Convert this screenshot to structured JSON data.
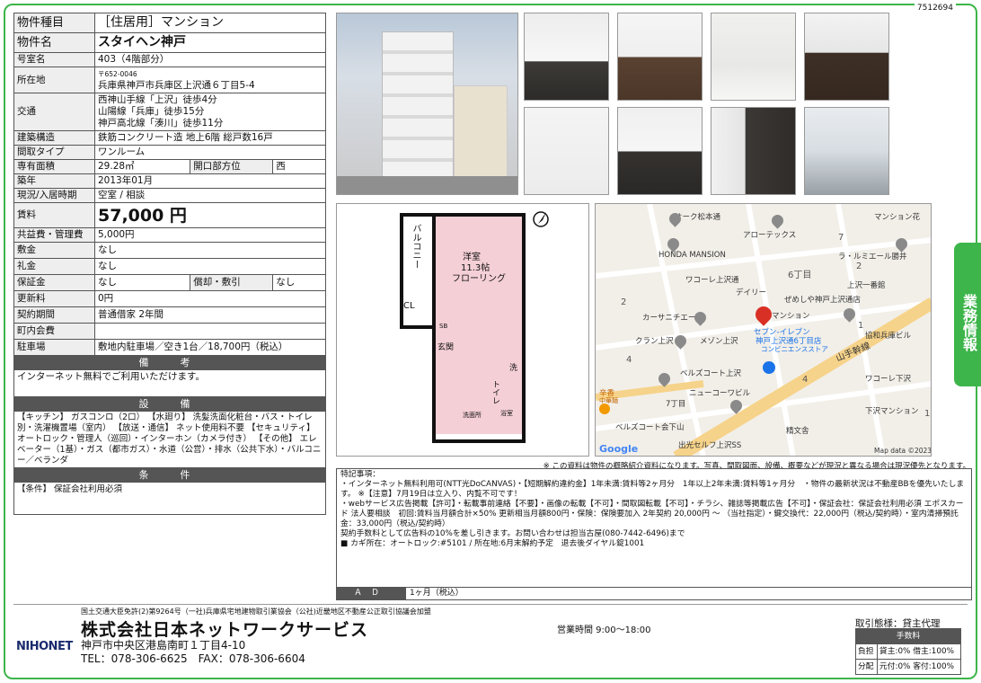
{
  "doc_id": "7512694",
  "side_tab": "業務情報",
  "property": {
    "type_label": "物件種目",
    "type_value": "［住居用］マンション",
    "name_label": "物件名",
    "name_value": "スタイヘン神戸",
    "room_label": "号室名",
    "room_value": "403（4階部分）",
    "location_label": "所在地",
    "postal": "〒652-0046",
    "address": "兵庫県神戸市兵庫区上沢通６丁目5-4",
    "access_label": "交通",
    "access": [
      "西神山手線「上沢」徒歩4分",
      "山陽線「兵庫」徒歩15分",
      "神戸高北線「湊川」徒歩11分"
    ],
    "structure_label": "建築構造",
    "structure_value": "鉄筋コンクリート造 地上6階 総戸数16戸",
    "layout_label": "間取タイプ",
    "layout_value": "ワンルーム",
    "area_label": "専有面積",
    "area_value": "29.28㎡",
    "direction_label": "開口部方位",
    "direction_value": "西",
    "built_label": "築年",
    "built_value": "2013年01月",
    "status_label": "現況/入居時期",
    "status_value": "空室 / 相談",
    "rent_label": "賃料",
    "rent_value": "57,000 円",
    "fee_label": "共益費・管理費",
    "fee_value": "5,000円",
    "deposit_label": "敷金",
    "deposit_value": "なし",
    "key_label": "礼金",
    "key_value": "なし",
    "guarantee_label": "保証金",
    "guarantee_value": "なし",
    "amort_label": "償却・敷引",
    "amort_value": "なし",
    "renewal_label": "更新料",
    "renewal_value": "0円",
    "contract_label": "契約期間",
    "contract_value": "普通借家 2年間",
    "town_label": "町内会費",
    "town_value": "",
    "parking_label": "駐車場",
    "parking_value": "敷地内駐車場／空き1台／18,700円（税込）"
  },
  "sections": {
    "remarks_title": "備　考",
    "remarks_body": "インターネット無料でご利用いただけます。",
    "equipment_title": "設　備",
    "equipment_body": "【キッチン】 ガスコンロ（2口） 【水廻り】 洗髪洗面化粧台・バス・トイレ別・洗濯機置場（室内） 【放送・通信】 ネット使用料不要 【セキュリティ】 オートロック・管理人（巡回）・インターホン（カメラ付き） 【その他】 エレベーター（1基）・ガス（都市ガス）・水道（公営）・排水（公共下水）・バルコニー／ベランダ",
    "conditions_title": "条　件",
    "conditions_body": "【条件】 保証会社利用必須"
  },
  "floorplan": {
    "balcony": "バルコニー",
    "room": "洋室",
    "size": "11.3帖",
    "floor": "フローリング",
    "cl": "CL",
    "sb": "SB",
    "entrance": "玄関",
    "wash": "洗",
    "toilet": "トイレ",
    "bath": "浴室",
    "washroom": "洗面所"
  },
  "map": {
    "labels": [
      "オーク松本通",
      "マンション花",
      "アローテックス",
      "HONDA MANSION",
      "ラ・ルミエール勝井",
      "ワコーレ上沢通",
      "6丁目",
      "上沢一番館",
      "デイリー",
      "ぜめしや神戸上沢通店",
      "カーサニチエー",
      "マンション",
      "クラン上沢",
      "メゾン上沢",
      "セブン-イレブン",
      "神戸上沢通6丁目店",
      "コンビニエンスストア",
      "協和兵庫ビル",
      "山手幹線",
      "ベルズコート上沢",
      "ワコーレ下沢",
      "ニューコーワビル",
      "辛香",
      "中華麺",
      "7丁目",
      "下沢マンション",
      "ベルズコート会下山",
      "精文舎",
      "出光セルフ上沢SS",
      "Google",
      "Map data ©2023"
    ],
    "numbers": [
      "7",
      "2",
      "2",
      "4",
      "1",
      "4",
      "1"
    ]
  },
  "disclaimer": "※ この資料は物件の概略紹介資料になります。写真、間取図面、設備、概要などが現況と異なる場合は現況優先となります。",
  "special": {
    "title": "特記事項：",
    "lines": [
      "・インターネット無料利用可(NTT光DoCANVAS)・【短期解約違約金】1年未満:賃料等2ヶ月分　1年以上2年未満:賃料等1ヶ月分　・物件の最新状況は不動産BBを優先いたします。 ※【注意】7月19日は立入り、内覧不可です！",
      "・webサービス広告掲載【許可】・転載事前連絡【不要】・画像の転載【不可】・間取図転載【不可】・チラシ、雑誌等掲載広告【不可】・保証会社：保証会社利用必須 エポスカード 法人要相談　初回:賃料当月額合計×50% 更新相当月額800円・保険：保険要加入 2年契約 20,000円 ～ （当社指定）・鍵交換代：22,000円（税込/契約時）・室内清掃預託金：33,000円（税込/契約時）",
      "契約手数料として広告料の10%を差し引きます。お問い合わせは担当古屋(080-7442-6496)まで",
      "■ カギ所在：オートロック:#5101 / 所在地:6月末解約予定　退去後ダイヤル錠1001"
    ],
    "ad_label": "ＡＤ",
    "ad_value": "1ヶ月（税込）"
  },
  "footer": {
    "license": "国土交通大臣免許(2)第9264号（一社)兵庫県宅地建物取引業協会（公社)近畿地区不動産公正取引協議会加盟",
    "logo": "NIHONET",
    "company": "株式会社日本ネットワークサービス",
    "address": "神戸市中央区港島南町１丁目4-10",
    "tel": "TEL：078-306-6625　FAX：078-306-6604",
    "hours": "営業時間 9:00～18:00",
    "terms_title": "取引態様：貸主代理",
    "fee_header": "手数料",
    "burden_label": "負担",
    "burden_value": "貸主:0% 借主:100%",
    "split_label": "分配",
    "split_value": "元付:0% 客付:100%"
  },
  "colors": {
    "accent": "#3db54a",
    "header": "#555555"
  }
}
